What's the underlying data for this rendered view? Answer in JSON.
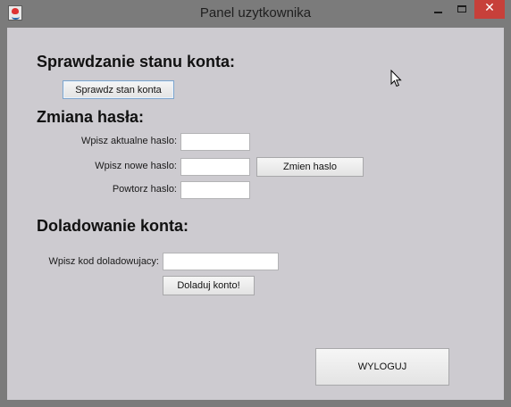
{
  "window": {
    "title": "Panel uzytkownika"
  },
  "sections": {
    "balance": {
      "heading": "Sprawdzanie stanu konta:",
      "check_button": "Sprawdz stan konta"
    },
    "password": {
      "heading": "Zmiana hasła:",
      "current_label": "Wpisz aktualne haslo:",
      "current_value": "",
      "new_label": "Wpisz nowe haslo:",
      "new_value": "",
      "repeat_label": "Powtorz haslo:",
      "repeat_value": "",
      "change_button": "Zmien haslo"
    },
    "topup": {
      "heading": "Doladowanie konta:",
      "code_label": "Wpisz kod doladowujacy:",
      "code_value": "",
      "topup_button": "Doladuj konto!"
    }
  },
  "logout_button": "WYLOGUJ",
  "icons": {
    "app": "java-icon",
    "minimize": "minimize-icon",
    "maximize": "maximize-icon",
    "close": "close-icon",
    "cursor": "mouse-cursor-icon"
  },
  "colors": {
    "panel_bg": "#cdcbd0",
    "titlebar_bg": "#7b7b7b",
    "close_bg": "#c7403a"
  }
}
